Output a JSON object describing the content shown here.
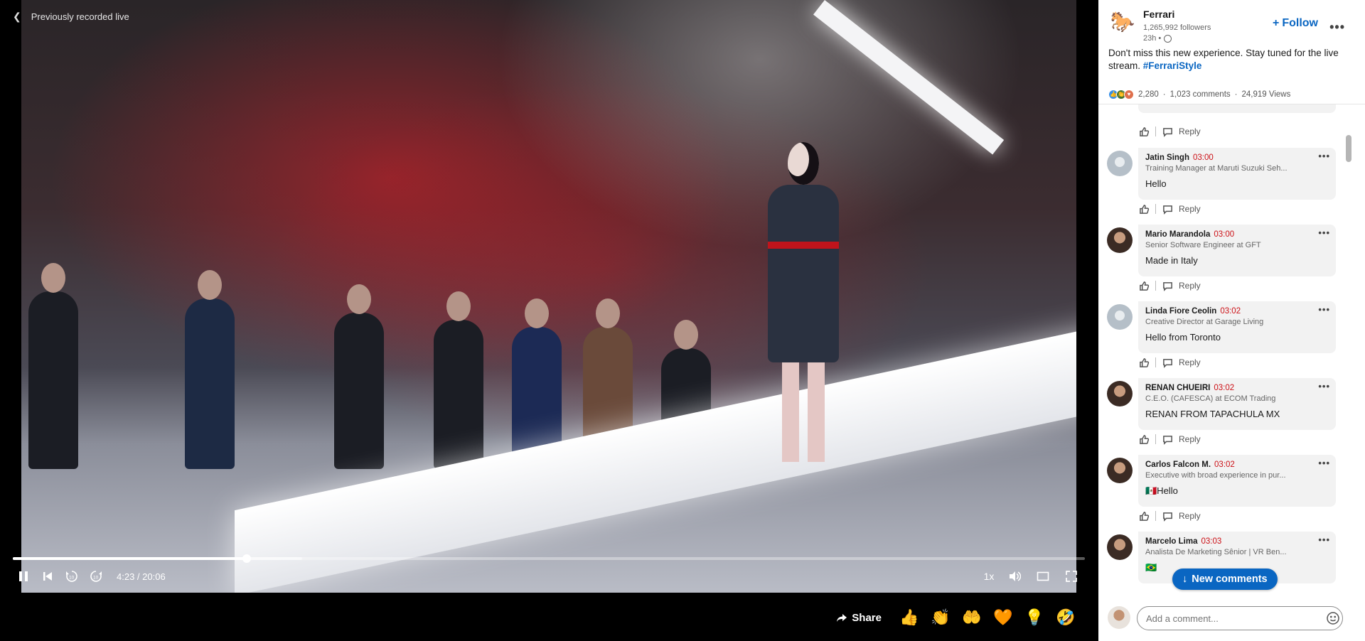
{
  "video": {
    "recorded_label": "Previously recorded live",
    "back_icon": "chevron-left-icon",
    "time_display": "4:23 / 20:06",
    "progress_fraction": 0.2185,
    "buffer_fraction": 0.27,
    "speed_label": "1x",
    "share_label": "Share",
    "reaction_buttons": [
      "like",
      "celebrate",
      "support",
      "love",
      "insightful",
      "funny"
    ]
  },
  "post": {
    "author": "Ferrari",
    "followers": "1,265,992 followers",
    "posted": "23h •",
    "follow_label": "Follow",
    "text": "Don't miss this new experience. Stay tuned for the live stream.",
    "hashtag": "#FerrariStyle",
    "reaction_count": "2,280",
    "comments_count": "1,023 comments",
    "views": "24,919 Views"
  },
  "comments": [
    {
      "name": "Jatin Singh",
      "time": "03:00",
      "headline": "Training Manager at Maruti Suzuki Seh...",
      "text": "Hello"
    },
    {
      "name": "Mario Marandola",
      "time": "03:00",
      "headline": "Senior Software Engineer at GFT",
      "text": "Made in Italy"
    },
    {
      "name": "Linda Fiore Ceolin",
      "time": "03:02",
      "headline": "Creative Director at Garage Living",
      "text": "Hello from Toronto"
    },
    {
      "name": "RENAN CHUEIRI",
      "time": "03:02",
      "headline": "C.E.O. (CAFESCA) at ECOM Trading",
      "text": "RENAN FROM TAPACHULA MX"
    },
    {
      "name": "Carlos Falcon M.",
      "time": "03:02",
      "headline": "Executive with broad experience in pur...",
      "text": "🇲🇽Hello"
    },
    {
      "name": "Marcelo Lima",
      "time": "03:03",
      "headline": "Analista De Marketing Sênior | VR Ben...",
      "text": "🇧🇷"
    }
  ],
  "reply_label": "Reply",
  "new_comments_label": "New comments",
  "add_comment_placeholder": "Add a comment...",
  "colors": {
    "accent": "#0a66c2",
    "timestamp": "#cc1016"
  }
}
